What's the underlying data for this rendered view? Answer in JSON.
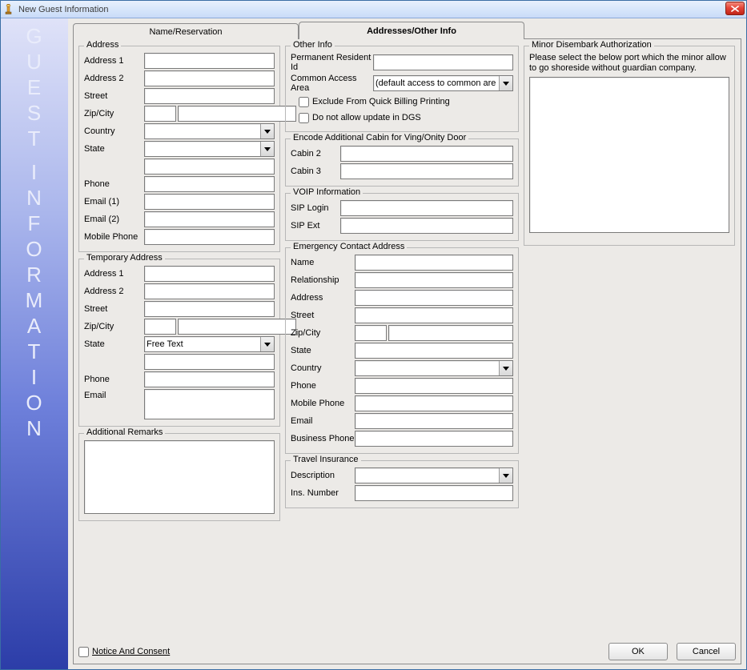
{
  "window": {
    "title": "New Guest Information"
  },
  "sidebar": {
    "text": "GUEST INFORMATION"
  },
  "tabs": {
    "tab0": "Name/Reservation",
    "tab1": "Addresses/Other Info"
  },
  "address": {
    "legend": "Address",
    "address1_label": "Address 1",
    "address2_label": "Address 2",
    "street_label": "Street",
    "zipcity_label": "Zip/City",
    "country_label": "Country",
    "state_label": "State",
    "phone_label": "Phone",
    "email1_label": "Email (1)",
    "email2_label": "Email (2)",
    "mobile_label": "Mobile Phone",
    "address1": "",
    "address2": "",
    "street": "",
    "zip": "",
    "city": "",
    "country": "",
    "state": "",
    "state_extra": "",
    "phone": "",
    "email1": "",
    "email2": "",
    "mobile": ""
  },
  "temp": {
    "legend": "Temporary Address",
    "address1_label": "Address 1",
    "address2_label": "Address 2",
    "street_label": "Street",
    "zipcity_label": "Zip/City",
    "state_label": "State",
    "phone_label": "Phone",
    "email_label": "Email",
    "address1": "",
    "address2": "",
    "street": "",
    "zip": "",
    "city": "",
    "state_selected": "Free Text",
    "state_extra": "",
    "phone": "",
    "email": ""
  },
  "remarks": {
    "legend": "Additional Remarks",
    "value": ""
  },
  "other": {
    "legend": "Other Info",
    "permres_label": "Permanent Resident Id",
    "caa_label": "Common Access Area",
    "caa_value": "(default access to common are",
    "exclude_label": "Exclude From Quick Billing Printing",
    "no_dgs_label": "Do not allow update in DGS",
    "permres": ""
  },
  "cabin": {
    "legend": "Encode Additional Cabin for Ving/Onity Door",
    "cabin2_label": "Cabin 2",
    "cabin3_label": "Cabin 3",
    "cabin2": "",
    "cabin3": ""
  },
  "voip": {
    "legend": "VOIP Information",
    "sip_login_label": "SIP Login",
    "sip_ext_label": "SIP Ext",
    "sip_login": "",
    "sip_ext": ""
  },
  "emerg": {
    "legend": "Emergency Contact Address",
    "name_label": "Name",
    "relationship_label": "Relationship",
    "address_label": "Address",
    "street_label": "Street",
    "zipcity_label": "Zip/City",
    "state_label": "State",
    "country_label": "Country",
    "phone_label": "Phone",
    "mobile_label": "Mobile Phone",
    "email_label": "Email",
    "business_label": "Business Phone",
    "name": "",
    "relationship": "",
    "address": "",
    "street": "",
    "zip": "",
    "city": "",
    "state": "",
    "country": "",
    "phone": "",
    "mobile": "",
    "email": "",
    "business": ""
  },
  "insurance": {
    "legend": "Travel Insurance",
    "desc_label": "Description",
    "num_label": "Ins. Number",
    "desc": "",
    "num": ""
  },
  "minor": {
    "legend": "Minor Disembark  Authorization",
    "instruction": "Please select the below port which the minor allow to go shoreside without guardian company."
  },
  "footer": {
    "notice_label": "Notice And Consent",
    "ok": "OK",
    "cancel": "Cancel"
  }
}
